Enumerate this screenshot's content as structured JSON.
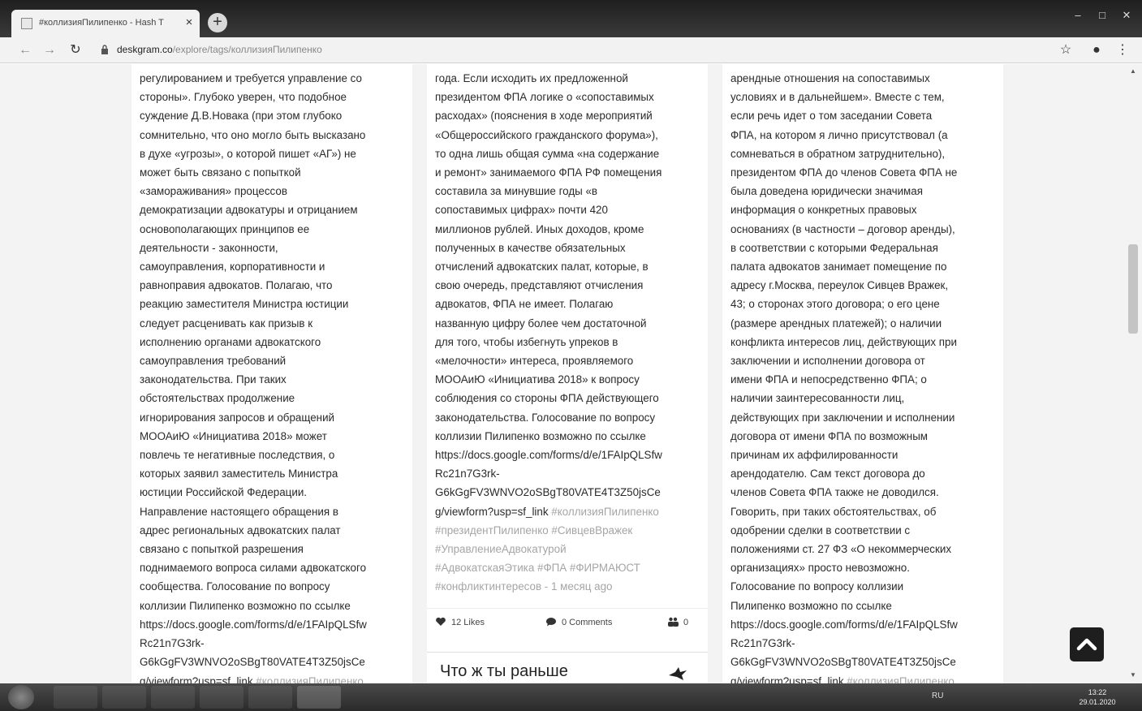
{
  "browser": {
    "tab_title": "#коллизияПилипенко - Hash T",
    "tab_close": "×",
    "new_tab": "+",
    "url_host": "deskgram.co",
    "url_path": "/explore/tags/коллизияПилипенко"
  },
  "columns": [
    {
      "lines": [
        "регулированием и требуется управление со",
        "стороны». Глубоко уверен, что подобное",
        "суждение Д.В.Новака (при этом глубоко",
        "сомнительно, что оно могло быть высказано",
        "в духе «угрозы», о которой пишет «АГ») не",
        "может быть связано с попыткой",
        "«замораживания» процессов",
        "демократизации адвокатуры и отрицанием",
        "основополагающих принципов ее",
        "деятельности - законности,",
        "самоуправления, корпоративности и",
        "равноправия адвокатов. Полагаю, что",
        "реакцию  заместителя Министра юстиции",
        "следует расценивать как призыв к",
        "исполнению органами адвокатского",
        "самоуправления требований",
        "законодательства. При таких",
        "обстоятельствах продолжение",
        "игнорирования запросов и обращений",
        "МООАиЮ «Инициатива 2018» может",
        "повлечь те негативные последствия, о",
        "которых заявил заместитель Министра",
        "юстиции Российской Федерации.",
        "Направление настоящего обращения в",
        "адрес региональных адвокатских палат",
        "связано с попыткой разрешения",
        "поднимаемого вопроса силами адвокатского",
        "сообщества.    Голосование по вопросу",
        "коллизии Пилипенко возможно по ссылке",
        "https://docs.google.com/forms/d/e/1FAIpQLSfw",
        "Rc21n7G3rk-",
        "G6kGgFV3WNVO2oSBgT80VATE4T3Z50jsCe"
      ],
      "last_line": "g/viewform?usp=sf_link",
      "last_tags": " #коллизияПилипенко"
    },
    {
      "lines": [
        "года. Если исходить их предложенной",
        "президентом ФПА логике о «сопоставимых",
        "расходах» (пояснения в ходе мероприятий",
        "«Общероссийского гражданского форума»),",
        "то одна лишь общая сумма «на содержание",
        "и ремонт» занимаемого ФПА РФ помещения",
        "составила за минувшие годы «в",
        "сопоставимых цифрах» почти 420",
        "миллионов рублей.  Иных доходов, кроме",
        "полученных в качестве обязательных",
        "отчислений адвокатских палат, которые, в",
        "свою очередь, представляют отчисления",
        "адвокатов, ФПА не имеет. Полагаю",
        "названную цифру более чем достаточной",
        "для того, чтобы избегнуть упреков в",
        "«мелочности» интереса, проявляемого",
        "МООАиЮ «Инициатива 2018» к вопросу",
        "соблюдения со стороны ФПА действующего",
        "законодательства. Голосование по вопросу",
        "коллизии Пилипенко возможно по ссылке",
        "https://docs.google.com/forms/d/e/1FAIpQLSfw",
        "Rc21n7G3rk-",
        "G6kGgFV3WNVO2oSBgT80VATE4T3Z50jsCe"
      ],
      "link_line": "g/viewform?usp=sf_link",
      "link_tags": " #коллизияПилипенко",
      "tag_lines": [
        "#президентПилипенко #СивцевВражек",
        "#УправлениеАдвокатурой",
        "#АдвокатскаяЭтика #ФПА #ФИРМАЮСТ",
        "#конфликтинтересов - 1 месяц ago"
      ],
      "likes": "12 Likes",
      "comments": "0 Comments",
      "people": "0",
      "next_post_title": "Что ж ты раньше"
    },
    {
      "lines": [
        "арендные отношения на сопоставимых",
        "условиях и в дальнейшем». Вместе с тем,",
        "если речь идет о том заседании Совета",
        "ФПА, на котором я лично присутствовал (а",
        "сомневаться в обратном затруднительно),",
        "президентом ФПА до членов Совета ФПА не",
        "была доведена юридически значимая",
        "информация о конкретных правовых",
        "основаниях (в частности – договор аренды),",
        "в соответствии с которыми Федеральная",
        "палата адвокатов занимает помещение по",
        "адресу г.Москва, переулок Сивцев Вражек,",
        "43; о сторонах этого договора; о его цене",
        "(размере арендных платежей); о наличии",
        "конфликта интересов лиц, действующих при",
        "заключении и исполнении договора от",
        "имени ФПА и непосредственно ФПА; о",
        "наличии заинтересованности лиц,",
        "действующих при заключении и исполнении",
        "договора от имени ФПА по возможным",
        "причинам их аффилированности",
        "арендодателю. Сам текст договора до",
        "членов Совета ФПА также не доводился.",
        "Говорить, при таких обстоятельствах, об",
        "одобрении сделки в соответствии с",
        "положениями ст. 27 ФЗ «О некоммерческих",
        "организациях» просто невозможно.",
        "Голосование по вопросу коллизии",
        "Пилипенко возможно по ссылке",
        "https://docs.google.com/forms/d/e/1FAIpQLSfw",
        "Rc21n7G3rk-",
        "G6kGgFV3WNVO2oSBgT80VATE4T3Z50jsCe"
      ],
      "last_line": "g/viewform?usp=sf_link",
      "last_tags": " #коллизияПилипенко"
    }
  ],
  "taskbar": {
    "lang": "RU",
    "time": "13:22",
    "date": "29.01.2020"
  },
  "colors": {
    "text": "#2a2a2a",
    "tags": "#a5a5a5",
    "page_bg": "#f3f3f3",
    "card_bg": "#ffffff"
  },
  "icons": [
    "page-icon",
    "close-icon",
    "plus-icon",
    "back-icon",
    "forward-icon",
    "reload-icon",
    "lock-icon",
    "star-icon",
    "account-icon",
    "menu-icon",
    "heart-icon",
    "comment-icon",
    "people-icon",
    "chevron-up-icon"
  ]
}
